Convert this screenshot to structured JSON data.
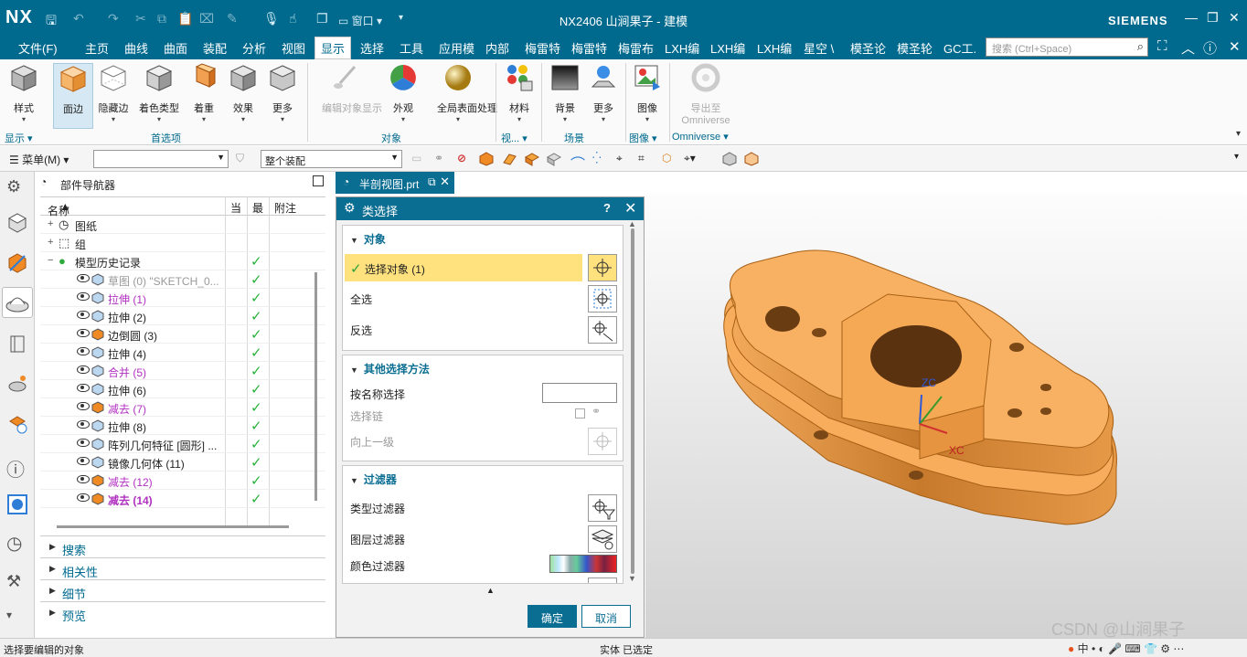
{
  "app": {
    "logo": "NX",
    "window_title": "NX2406 山涧果子 - 建模",
    "brand": "SIEMENS",
    "window_menu_label": "窗口",
    "accent_color": "#006a8e"
  },
  "menubar": {
    "items": [
      "文件(F)",
      "主页",
      "曲线",
      "曲面",
      "装配",
      "分析",
      "视图",
      "显示",
      "选择",
      "工具",
      "应用模",
      "内部",
      "梅雷特",
      "梅雷特",
      "梅雷布",
      "LXH编",
      "LXH编",
      "LXH编",
      "星空 \\",
      "模圣论",
      "模圣轮",
      "GC工."
    ],
    "active_index": 7,
    "search_placeholder": "搜索 (Ctrl+Space)"
  },
  "ribbon": {
    "buttons": [
      {
        "label": "样式",
        "icon": "shaded-cube-icon"
      },
      {
        "label": "面边",
        "icon": "face-edge-cube-icon"
      },
      {
        "label": "隐藏边",
        "icon": "hidden-edge-cube-icon"
      },
      {
        "label": "着色类型",
        "icon": "shading-type-icon"
      },
      {
        "label": "着重",
        "icon": "emphasis-icon"
      },
      {
        "label": "效果",
        "icon": "effect-icon"
      },
      {
        "label": "更多",
        "icon": "more-icon"
      },
      {
        "label": "编辑对象显示",
        "icon": "brush-icon"
      },
      {
        "label": "外观",
        "icon": "color-wheel-icon"
      },
      {
        "label": "全局表面处理",
        "icon": "gold-sphere-icon"
      },
      {
        "label": "材料",
        "icon": "materials-icon"
      },
      {
        "label": "背景",
        "icon": "background-icon"
      },
      {
        "label": "更多",
        "icon": "more-scene-icon"
      },
      {
        "label": "图像",
        "icon": "image-icon"
      },
      {
        "label": "导出至",
        "label2": "Omniverse",
        "icon": "omniverse-icon"
      }
    ],
    "groups": [
      "显示",
      "首选项",
      "对象",
      "视...",
      "场景",
      "图像",
      "Omniverse"
    ]
  },
  "selbar": {
    "menu_label": "菜单(M)",
    "filter_value": "",
    "scope_value": "整个装配"
  },
  "navigator": {
    "title": "部件导航器",
    "columns": [
      "名称",
      "当",
      "最",
      "附注"
    ],
    "rows": [
      {
        "label": "图纸",
        "style": "normal"
      },
      {
        "label": "组",
        "style": "normal"
      },
      {
        "label": "模型历史记录",
        "style": "normal"
      },
      {
        "label": "草图 (0) \"SKETCH_0...",
        "style": "gray"
      },
      {
        "label": "拉伸 (1)",
        "style": "magenta"
      },
      {
        "label": "拉伸 (2)",
        "style": "normal"
      },
      {
        "label": "边倒圆 (3)",
        "style": "normal"
      },
      {
        "label": "拉伸 (4)",
        "style": "normal"
      },
      {
        "label": "合并 (5)",
        "style": "magenta"
      },
      {
        "label": "拉伸 (6)",
        "style": "normal"
      },
      {
        "label": "减去 (7)",
        "style": "magenta"
      },
      {
        "label": "拉伸 (8)",
        "style": "normal"
      },
      {
        "label": "阵列几何特征 [圆形] ...",
        "style": "normal"
      },
      {
        "label": "镜像几何体 (11)",
        "style": "normal"
      },
      {
        "label": "减去 (12)",
        "style": "magenta"
      },
      {
        "label": "减去 (14)",
        "style": "magenta-bold"
      }
    ],
    "panels": [
      "搜索",
      "相关性",
      "细节",
      "预览"
    ]
  },
  "tab": {
    "label": "半剖视图.prt"
  },
  "dialog": {
    "title": "类选择",
    "help": "?",
    "sections": {
      "object": {
        "header": "对象",
        "select_object": "选择对象 (1)",
        "select_all": "全选",
        "invert": "反选"
      },
      "other": {
        "header": "其他选择方法",
        "by_name": "按名称选择",
        "chain": "选择链",
        "up_level": "向上一级"
      },
      "filter": {
        "header": "过滤器",
        "type_filter": "类型过滤器",
        "layer_filter": "图层过滤器",
        "color_filter": "颜色过滤器"
      }
    },
    "ok": "确定",
    "cancel": "取消"
  },
  "viewport": {
    "axis_zc": "ZC",
    "axis_xc": "XC",
    "part_color": "#f5a24a"
  },
  "statusbar": {
    "prompt": "选择要编辑的对象",
    "status": "实体 已选定",
    "watermark": "CSDN @山涧果子",
    "tray": "中"
  }
}
